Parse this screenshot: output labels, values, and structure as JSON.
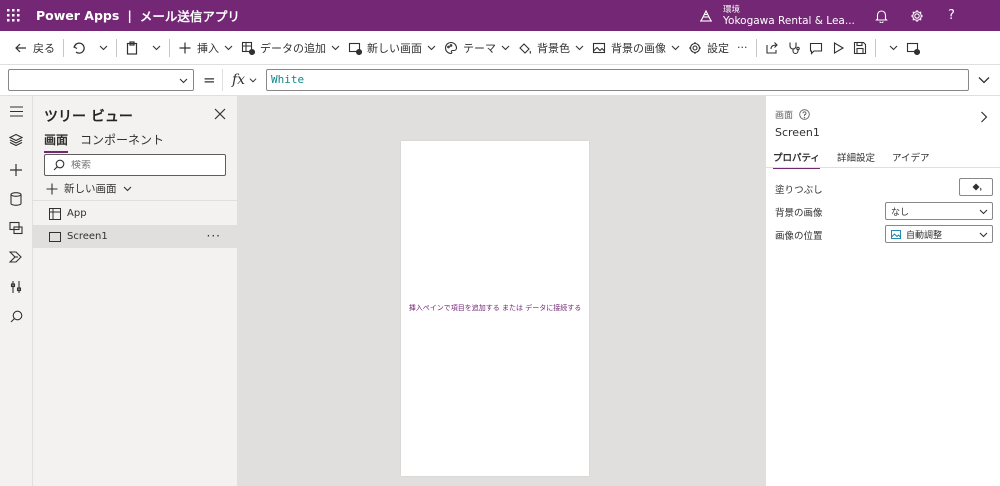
{
  "topbar": {
    "product": "Power Apps",
    "separator": "|",
    "app_name": "メール送信アプリ",
    "environment_label": "環境",
    "environment_name": "Yokogawa Rental & Lea...",
    "help_glyph": "?"
  },
  "commandbar": {
    "back": "戻る",
    "insert": "挿入",
    "add_data": "データの追加",
    "new_screen": "新しい画面",
    "theme": "テーマ",
    "background_color": "背景色",
    "background_image": "背景の画像",
    "settings": "設定",
    "more": "···"
  },
  "formulabar": {
    "property_value": "",
    "equals": "=",
    "fx": "fx",
    "formula": "White"
  },
  "tree": {
    "title": "ツリー ビュー",
    "tabs": [
      "画面",
      "コンポーネント"
    ],
    "search_placeholder": "検索",
    "new_screen": "新しい画面",
    "items": [
      {
        "label": "App"
      },
      {
        "label": "Screen1"
      }
    ],
    "more": "···"
  },
  "canvas": {
    "hint_part1": "挿入ペインで項目を追加する",
    "hint_part2": "または",
    "hint_part3": "データに接続する"
  },
  "props": {
    "kind": "画面",
    "name": "Screen1",
    "tabs": [
      "プロパティ",
      "詳細設定",
      "アイデア"
    ],
    "fill_label": "塗りつぶし",
    "bg_image_label": "背景の画像",
    "bg_image_value": "なし",
    "image_position_label": "画像の位置",
    "image_position_value": "自動調整"
  },
  "colors": {
    "brand": "#742774",
    "formula_text": "#0e8a8a"
  },
  "icons": {
    "waffle": "waffle-icon",
    "environment": "environment-icon",
    "notification": "bell-icon",
    "settings": "gear-icon"
  }
}
